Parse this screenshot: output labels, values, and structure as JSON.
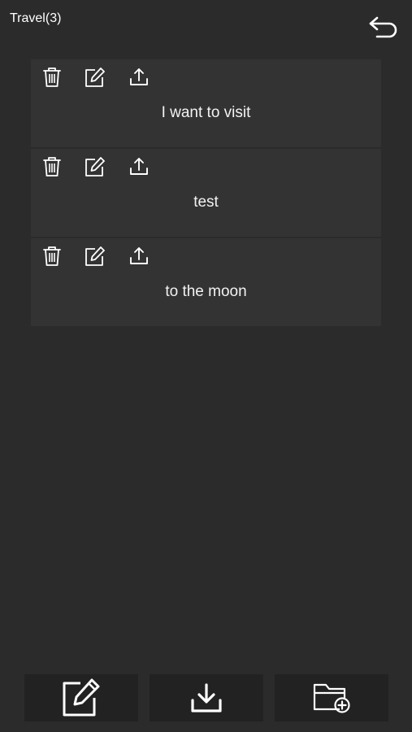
{
  "header": {
    "title": "Travel(3)",
    "back_icon": "undo-arrow-icon"
  },
  "notes": [
    {
      "text": "I want to visit",
      "icons": [
        "trash-icon",
        "edit-icon",
        "share-icon"
      ]
    },
    {
      "text": "test",
      "icons": [
        "trash-icon",
        "edit-icon",
        "share-icon"
      ]
    },
    {
      "text": "to the moon",
      "icons": [
        "trash-icon",
        "edit-icon",
        "share-icon"
      ]
    }
  ],
  "bottom_bar": {
    "buttons": [
      "new-note-icon",
      "download-icon",
      "add-folder-icon"
    ]
  },
  "colors": {
    "background": "#2b2b2b",
    "card": "#333333",
    "bottom_button": "#222222",
    "foreground": "#ffffff"
  }
}
